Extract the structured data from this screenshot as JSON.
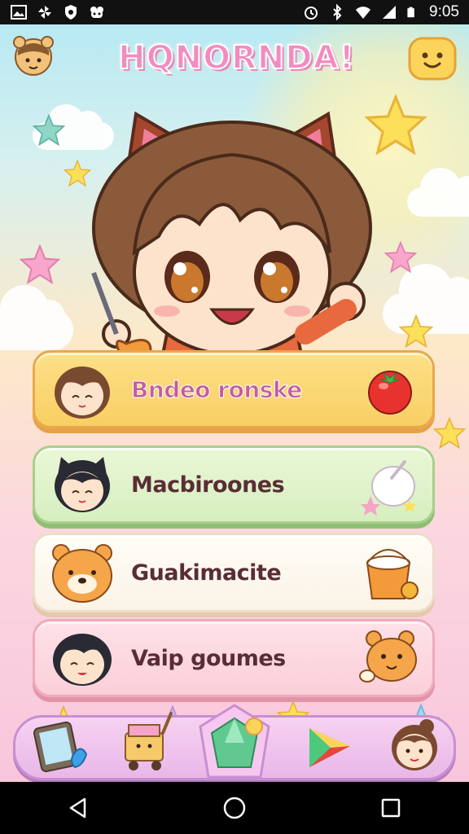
{
  "status_bar": {
    "time": "9:05",
    "left_icons": [
      "image-icon",
      "pinwheel-icon",
      "shield-icon",
      "gamepad-icon"
    ],
    "right_icons": [
      "alarm-icon",
      "bluetooth-icon",
      "wifi-icon",
      "signal-icon",
      "battery-icon"
    ]
  },
  "header": {
    "title": "HQNORNDA!",
    "left_button": "bear-avatar-icon",
    "right_button": "smiley-face-icon"
  },
  "menu": [
    {
      "label": "Bndeo ronske",
      "avatar": "sleeping-girl-icon",
      "item": "tomato-icon",
      "color": "#f8cf63"
    },
    {
      "label": "Macbiroones",
      "avatar": "cat-girl-icon",
      "item": "rice-bowl-icon",
      "color": "#d6efc0"
    },
    {
      "label": "Guakimacite",
      "avatar": "bear-cub-icon",
      "item": "bucket-icon",
      "color": "#fbf3e6"
    },
    {
      "label": "Vaip goumes",
      "avatar": "happy-boy-icon",
      "item": "dog-toy-icon",
      "color": "#fbcfd9"
    }
  ],
  "bottom_nav": [
    "tablet-icon",
    "cart-icon",
    "gem-icon",
    "play-store-icon",
    "girl-face-icon"
  ],
  "android_nav": [
    "back-icon",
    "home-icon",
    "recents-icon"
  ],
  "colors": {
    "accent_pink": "#f28cc0",
    "nav_purple": "#e9b7e8",
    "label_text": "#5a2d36"
  }
}
